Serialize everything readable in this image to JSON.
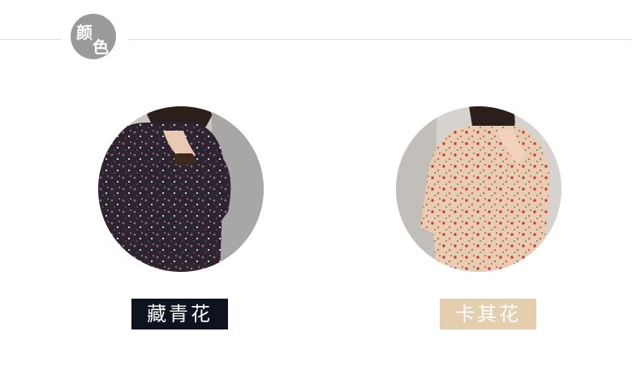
{
  "section": {
    "badge_char_1": "颜",
    "badge_char_2": "色"
  },
  "colors": [
    {
      "name": "藏青花",
      "label_bg": "#0f1320",
      "fabric": "#2b2530",
      "print": "#b05a78"
    },
    {
      "name": "卡其花",
      "label_bg": "#e3cfae",
      "fabric": "#e8cdb0",
      "print": "#c8364a"
    }
  ]
}
